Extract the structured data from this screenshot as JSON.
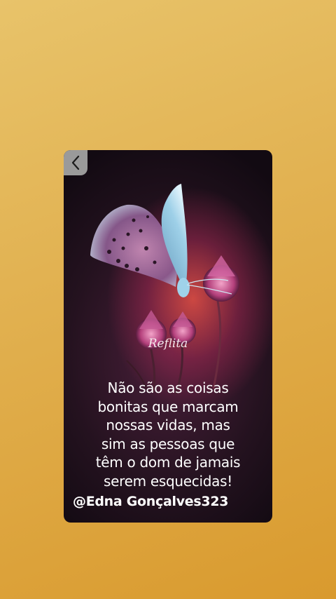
{
  "card": {
    "title": "Reflita",
    "quote_lines": [
      "Não são as coisas",
      "bonitas que marcam",
      "nossas vidas, mas",
      "sim as pessoas que",
      "têm o dom de jamais",
      "serem esquecidas!"
    ],
    "author_handle": "@Edna Gonçalves323"
  },
  "icons": {
    "back": "chevron-left-icon"
  },
  "colors": {
    "background_top": "#e8c36a",
    "background_bottom": "#d99a2e",
    "card_dark": "#24121f",
    "glow": "#e65046",
    "butterfly_blue": "#8fc6e0",
    "flower_pink": "#c0508a",
    "text": "#ffffff"
  }
}
